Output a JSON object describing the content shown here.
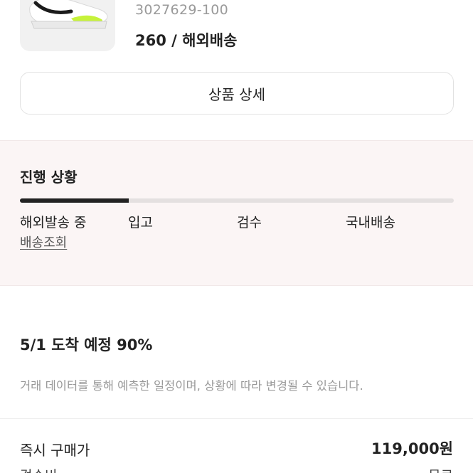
{
  "product": {
    "style_code": "3027629-100",
    "size_shipping": "260 / 해외배송"
  },
  "detail_button_label": "상품 상세",
  "progress": {
    "title": "진행 상황",
    "completed_fraction": 0.25,
    "steps": [
      "해외발송 중",
      "입고",
      "검수",
      "국내배송"
    ],
    "tracking_link": "배송조회"
  },
  "eta": {
    "headline": "5/1 도착 예정 90%",
    "note": "거래 데이터를 통해 예측한 일정이며, 상황에 따라 변경될 수 있습니다."
  },
  "price": {
    "instant_buy_label": "즉시 구매가",
    "instant_buy_value": "119,000원",
    "inspection_fee_label": "검수비",
    "inspection_fee_value": "무료"
  },
  "colors": {
    "accent": "#222222",
    "progress_bg": "#fbf5f5",
    "shoe_highlight": "#c6f23a"
  },
  "icons": {
    "product_image": "sneaker-image"
  }
}
